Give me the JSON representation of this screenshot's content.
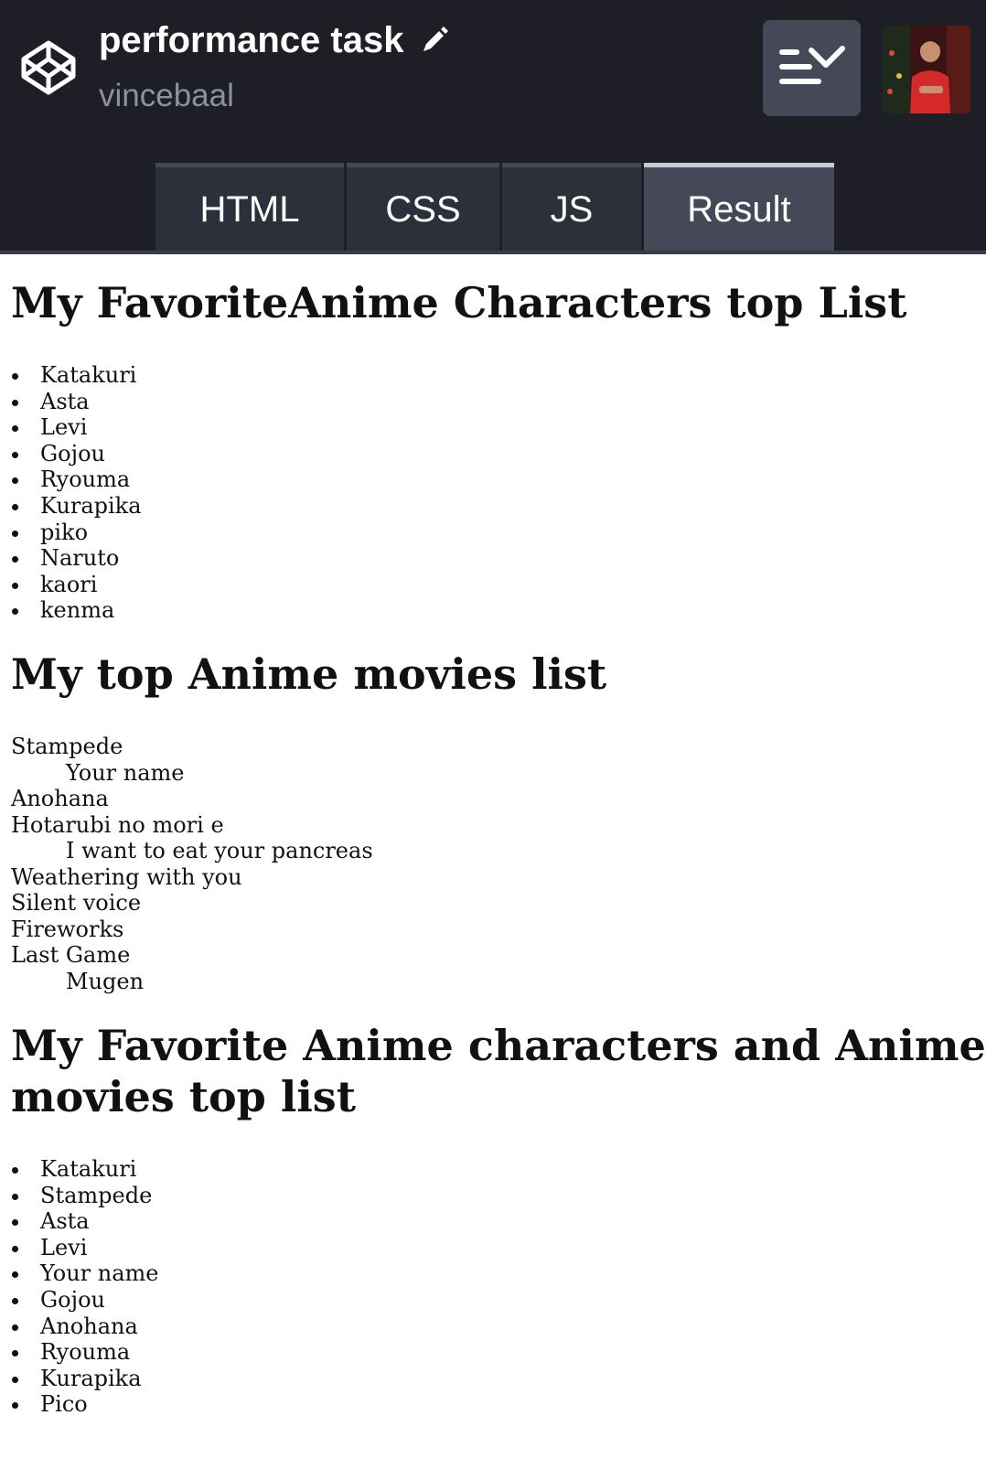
{
  "header": {
    "pen_title": "performance task",
    "username": "vincebaal",
    "logo_icon": "codepen-logo-icon",
    "edit_icon": "pencil-icon",
    "layout_icon": "change-view-icon",
    "avatar_icon": "user-avatar"
  },
  "tabs": [
    {
      "label": "HTML",
      "active": false
    },
    {
      "label": "CSS",
      "active": false
    },
    {
      "label": "JS",
      "active": false
    },
    {
      "label": "Result",
      "active": true
    }
  ],
  "result": {
    "section1": {
      "heading": "My FavoriteAnime Characters top List",
      "items": [
        "Katakuri",
        "Asta",
        "Levi",
        "Gojou",
        "Ryouma",
        "Kurapika",
        "piko",
        "Naruto",
        "kaori",
        "kenma"
      ]
    },
    "section2": {
      "heading": "My top Anime movies list",
      "lines": [
        {
          "text": "Stampede",
          "indent": false
        },
        {
          "text": "Your name",
          "indent": true
        },
        {
          "text": "Anohana",
          "indent": false
        },
        {
          "text": "Hotarubi no mori e",
          "indent": false
        },
        {
          "text": "I want to eat your pancreas",
          "indent": true
        },
        {
          "text": "Weathering with you",
          "indent": false
        },
        {
          "text": "Silent voice",
          "indent": false
        },
        {
          "text": "Fireworks",
          "indent": false
        },
        {
          "text": "Last Game",
          "indent": false
        },
        {
          "text": "Mugen",
          "indent": true
        }
      ]
    },
    "section3": {
      "heading_line1": "My Favorite Anime characters and Anime",
      "heading_line2": "movies top list",
      "items": [
        "Katakuri",
        "Stampede",
        "Asta",
        "Levi",
        "Your name",
        "Gojou",
        "Anohana",
        "Ryouma",
        "Kurapika",
        "Pico"
      ]
    }
  },
  "colors": {
    "topbar": "#1e1f26",
    "tab_bg": "#2c303a",
    "tab_active_bg": "#444857",
    "username": "#8e919c"
  }
}
